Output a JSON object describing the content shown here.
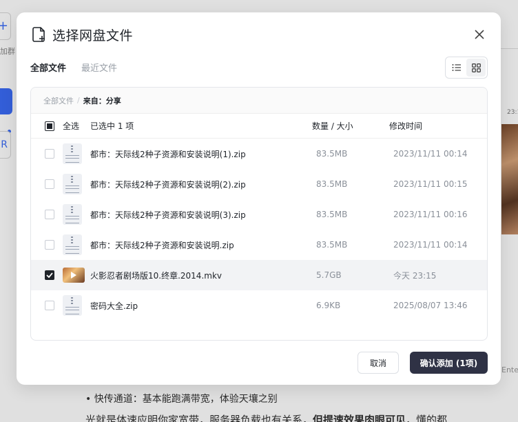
{
  "background": {
    "left_label": "加群",
    "right_time": "23:1",
    "right_enter": "Ente",
    "bullet_text": "•  快传通道：基本能跑满带宽，体验天壤之别",
    "para_prefix": "光就是体速应明你家宽带，服务器负载也有关系，",
    "para_bold": "但提速效果肉眼可见",
    "para_suffix": "，懂的都"
  },
  "modal": {
    "title": "选择网盘文件",
    "tabs": [
      {
        "label": "全部文件",
        "active": true
      },
      {
        "label": "最近文件",
        "active": false
      }
    ],
    "view_mode": "grid",
    "breadcrumb": {
      "root": "全部文件",
      "separator": "/",
      "current": "来自：分享"
    },
    "list_header": {
      "select_all": "全选",
      "selected_count": "已选中 1 项",
      "size_col": "数量 / 大小",
      "time_col": "修改时间"
    },
    "files": [
      {
        "name": "都市：天际线2种子资源和安装说明(1).zip",
        "size": "83.5MB",
        "time": "2023/11/11 00:14",
        "type": "zip",
        "checked": false
      },
      {
        "name": "都市：天际线2种子资源和安装说明(2).zip",
        "size": "83.5MB",
        "time": "2023/11/11 00:15",
        "type": "zip",
        "checked": false
      },
      {
        "name": "都市：天际线2种子资源和安装说明(3).zip",
        "size": "83.5MB",
        "time": "2023/11/11 00:16",
        "type": "zip",
        "checked": false
      },
      {
        "name": "都市：天际线2种子资源和安装说明.zip",
        "size": "83.5MB",
        "time": "2023/11/11 00:14",
        "type": "zip",
        "checked": false
      },
      {
        "name": "火影忍者剧场版10.终章.2014.mkv",
        "size": "5.7GB",
        "time": "今天 23:15",
        "type": "video",
        "checked": true
      },
      {
        "name": "密码大全.zip",
        "size": "6.9KB",
        "time": "2025/08/07 13:46",
        "type": "zip",
        "checked": false
      }
    ],
    "cancel_label": "取消",
    "confirm_label": "确认添加 (1项)",
    "colors": {
      "confirm_bg": "#2f3245",
      "selected_row_bg": "#f2f3f5",
      "accent_blue": "#3b6cf6"
    }
  }
}
